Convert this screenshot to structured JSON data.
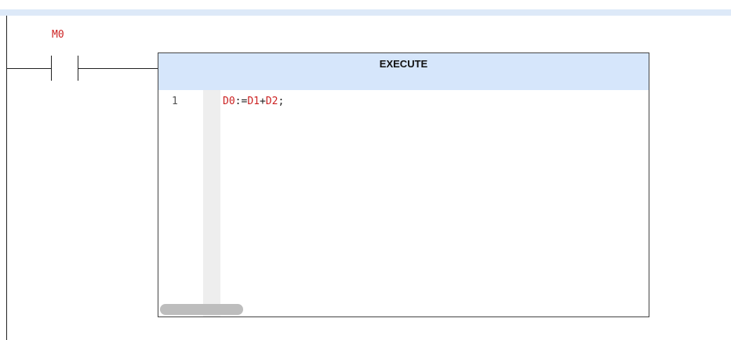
{
  "rung": {
    "contact": {
      "label": "M0",
      "type": "normally-open-contact"
    },
    "instruction": {
      "title": "EXECUTE",
      "code_lines": [
        {
          "number": "1",
          "text": "D0:=D1+D2;"
        }
      ]
    }
  },
  "colors": {
    "variable": "#cc2222",
    "header_bg": "#d6e6fb",
    "top_strip": "#dde9f8",
    "gutter": "#eeeeee",
    "scroll_thumb": "#bdbdbd"
  }
}
